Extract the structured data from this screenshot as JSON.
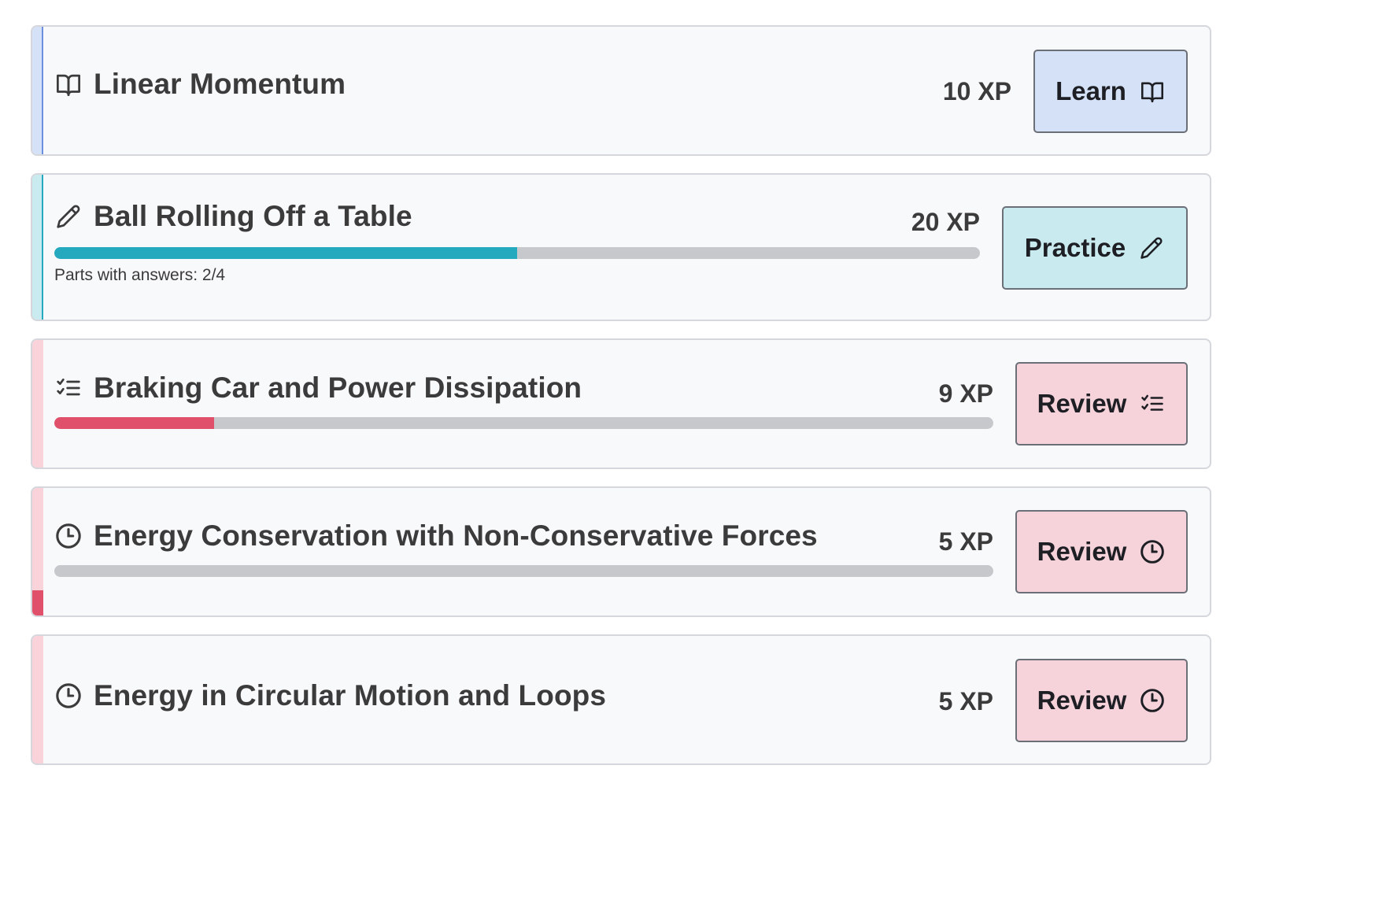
{
  "colors": {
    "learn_accent": "#6d8fe0",
    "practice_accent": "#24a9bf",
    "review_accent": "#e0506a",
    "review_stripe_light": "#f9d2da",
    "track": "#c7c8cb"
  },
  "items": [
    {
      "title": "Linear Momentum",
      "icon": "book-open-icon",
      "xp": "10 XP",
      "button_label": "Learn",
      "button_icon": "book-open-icon"
    },
    {
      "title": "Ball Rolling Off a Table",
      "icon": "pencil-icon",
      "xp": "20 XP",
      "button_label": "Practice",
      "button_icon": "pencil-icon",
      "progress": 0.5,
      "note": "Parts with answers: 2/4"
    },
    {
      "title": "Braking Car and Power Dissipation",
      "icon": "checklist-icon",
      "xp": "9 XP",
      "button_label": "Review",
      "button_icon": "checklist-icon",
      "progress": 0.17
    },
    {
      "title": "Energy Conservation with Non-Conservative Forces",
      "icon": "clock-icon",
      "xp": "5 XP",
      "button_label": "Review",
      "button_icon": "clock-icon",
      "progress": 0,
      "stripe_progress": 0.2
    },
    {
      "title": "Energy in Circular Motion and Loops",
      "icon": "clock-icon",
      "xp": "5 XP",
      "button_label": "Review",
      "button_icon": "clock-icon"
    }
  ]
}
